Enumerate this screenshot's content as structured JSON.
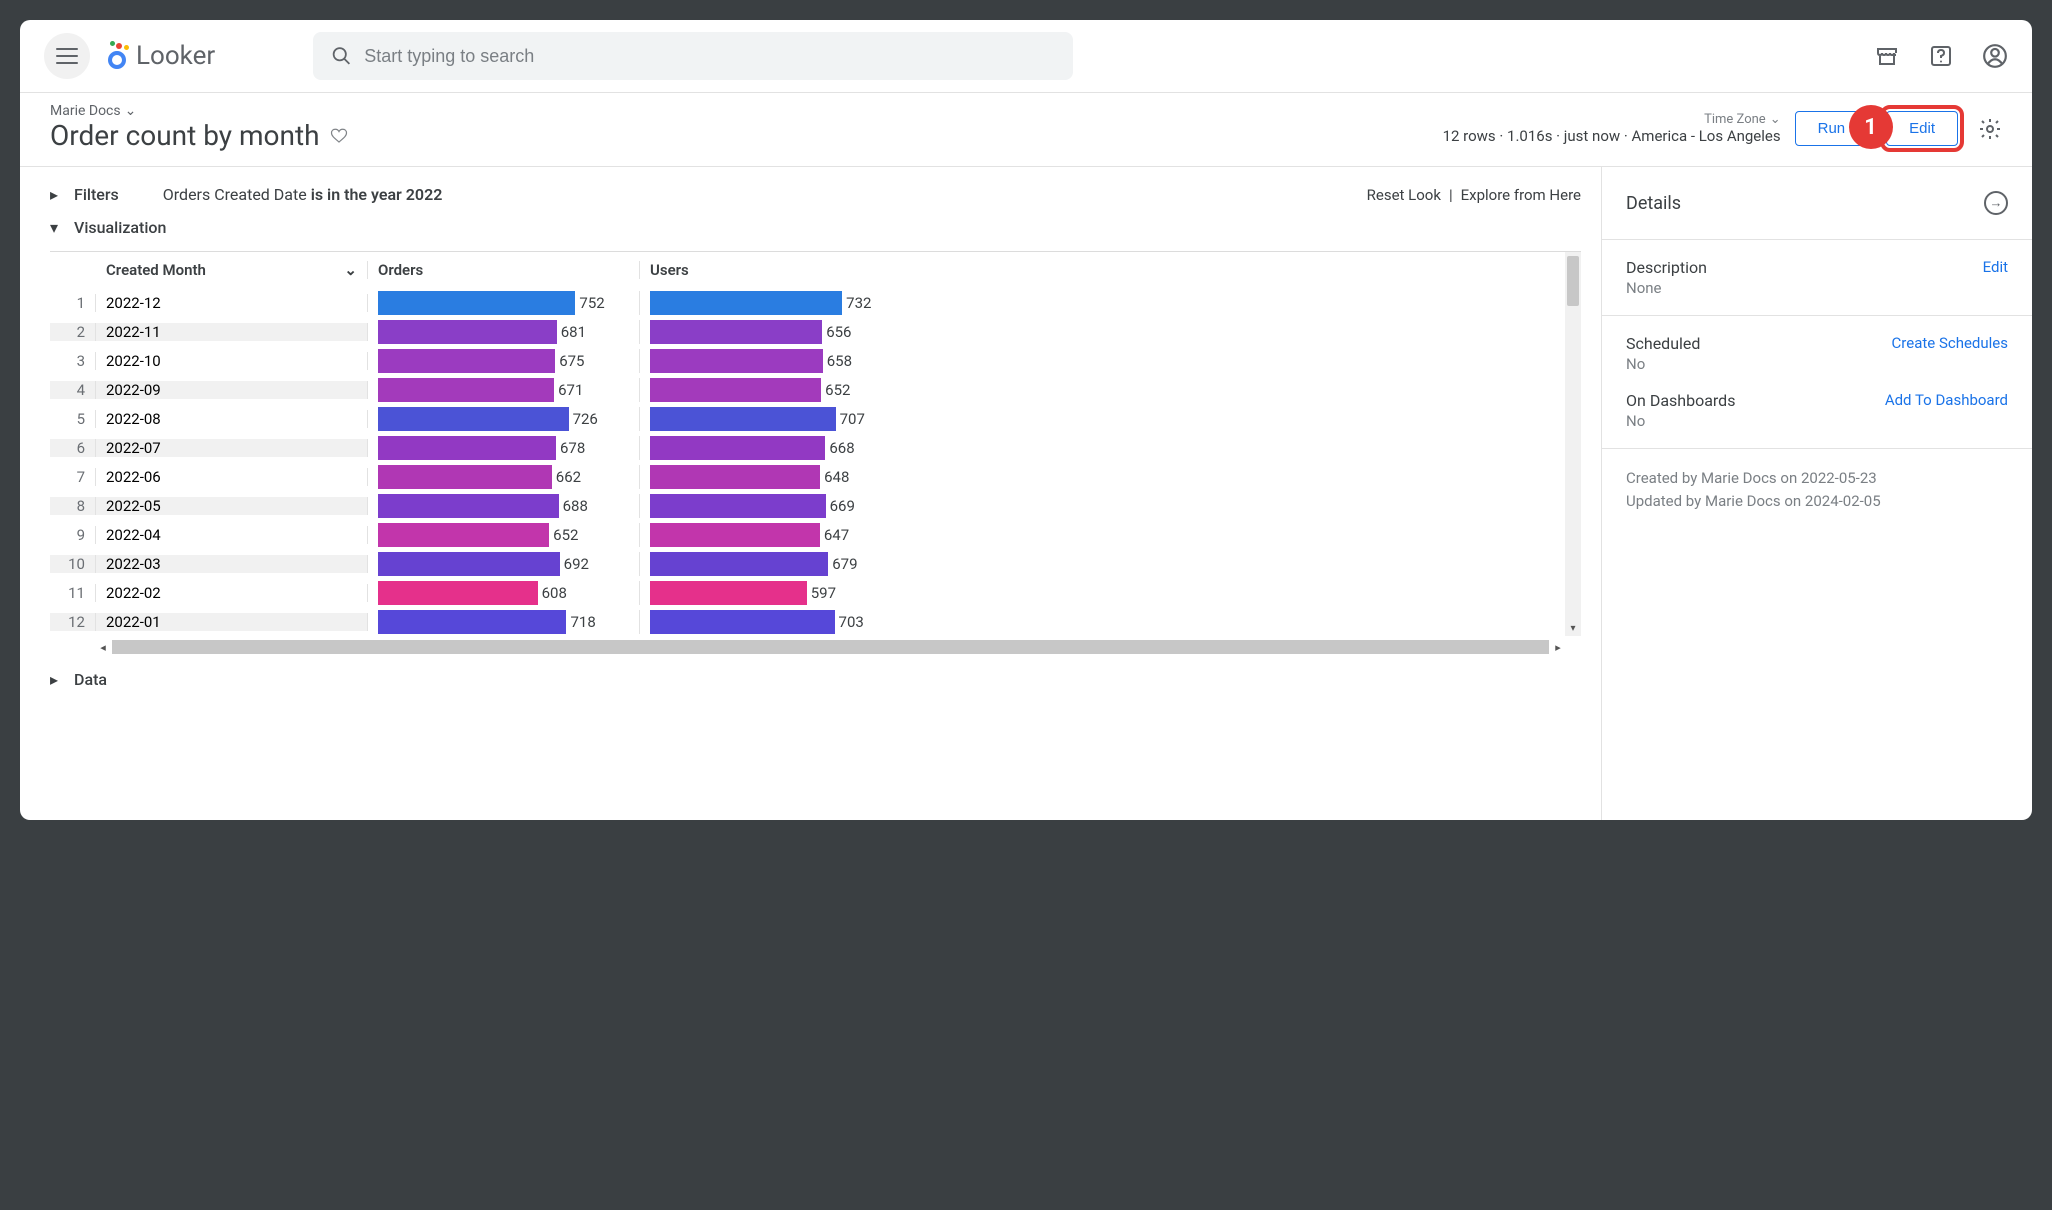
{
  "header": {
    "logo_text": "Looker",
    "search_placeholder": "Start typing to search"
  },
  "breadcrumb": "Marie Docs",
  "page_title": "Order count by month",
  "time_zone_label": "Time Zone",
  "status_line": "12 rows · 1.016s · just now · America - Los Angeles",
  "buttons": {
    "run": "Run",
    "edit": "Edit"
  },
  "annotation": "1",
  "filters": {
    "label": "Filters",
    "desc_prefix": "Orders Created Date ",
    "desc_bold": "is in the year 2022",
    "reset": "Reset Look",
    "explore": "Explore from Here"
  },
  "viz_label": "Visualization",
  "data_label": "Data",
  "columns": {
    "month": "Created Month",
    "orders": "Orders",
    "users": "Users"
  },
  "details": {
    "title": "Details",
    "description_label": "Description",
    "description_value": "None",
    "description_action": "Edit",
    "scheduled_label": "Scheduled",
    "scheduled_value": "No",
    "scheduled_action": "Create Schedules",
    "dash_label": "On Dashboards",
    "dash_value": "No",
    "dash_action": "Add To Dashboard",
    "created": "Created by Marie Docs on 2022-05-23",
    "updated": "Updated by Marie Docs on 2024-02-05"
  },
  "chart_data": {
    "type": "bar",
    "orientation": "horizontal",
    "title": "Order count by month",
    "categories": [
      "2022-12",
      "2022-11",
      "2022-10",
      "2022-09",
      "2022-08",
      "2022-07",
      "2022-06",
      "2022-05",
      "2022-04",
      "2022-03",
      "2022-02",
      "2022-01"
    ],
    "series": [
      {
        "name": "Orders",
        "values": [
          752,
          681,
          675,
          671,
          726,
          678,
          662,
          688,
          652,
          692,
          608,
          718
        ]
      },
      {
        "name": "Users",
        "values": [
          732,
          656,
          658,
          652,
          707,
          668,
          648,
          669,
          647,
          679,
          597,
          703
        ]
      }
    ],
    "colors": [
      "#2a7de1",
      "#8a3ec7",
      "#9b3bc0",
      "#a33abb",
      "#4b53d6",
      "#9239c3",
      "#b037b4",
      "#7c3dcc",
      "#c235ab",
      "#6642d1",
      "#e5308b",
      "#5648d9"
    ],
    "row_colors_note": "one color per category row applied to both series",
    "max_scale": 800
  }
}
